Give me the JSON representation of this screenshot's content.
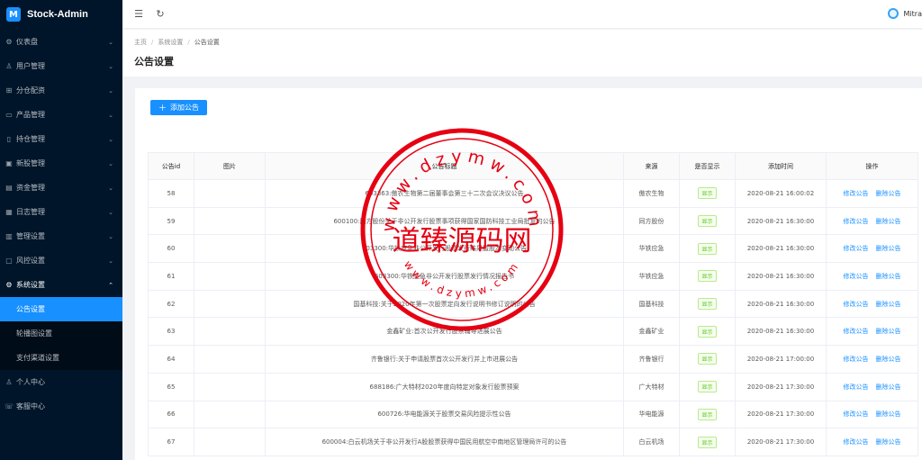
{
  "brand": {
    "logo_letter": "M",
    "name": "Stock-Admin"
  },
  "sidebar": {
    "items": [
      {
        "icon": "dashboard-icon",
        "glyph": "⚙",
        "label": "仪表盘"
      },
      {
        "icon": "user-group-icon",
        "glyph": "♙",
        "label": "用户管理"
      },
      {
        "icon": "org-icon",
        "glyph": "⊞",
        "label": "分仓配资"
      },
      {
        "icon": "product-icon",
        "glyph": "▭",
        "label": "产品管理"
      },
      {
        "icon": "position-icon",
        "glyph": "▯",
        "label": "持仓管理"
      },
      {
        "icon": "stock-icon",
        "glyph": "▣",
        "label": "新股管理"
      },
      {
        "icon": "money-icon",
        "glyph": "▤",
        "label": "资金管理"
      },
      {
        "icon": "log-icon",
        "glyph": "▦",
        "label": "日志管理"
      },
      {
        "icon": "manage-icon",
        "glyph": "▥",
        "label": "管理设置"
      },
      {
        "icon": "risk-icon",
        "glyph": "▢",
        "label": "风控设置"
      }
    ],
    "open_item": {
      "icon": "gear-icon",
      "glyph": "⚙",
      "label": "系统设置"
    },
    "sub_items": [
      "公告设置",
      "轮播图设置",
      "支付渠道设置"
    ],
    "bottom_items": [
      {
        "icon": "person-icon",
        "glyph": "♙",
        "label": "个人中心"
      },
      {
        "icon": "service-icon",
        "glyph": "☏",
        "label": "客服中心"
      }
    ]
  },
  "header": {
    "user_name": "Mitra"
  },
  "breadcrumb": [
    "主页",
    "系统设置",
    "公告设置"
  ],
  "page_title": "公告设置",
  "add_button": "添加公告",
  "table": {
    "columns": [
      "公告id",
      "图片",
      "公告标题",
      "来源",
      "是否显示",
      "添加时间",
      "操作"
    ],
    "rows": [
      {
        "id": "58",
        "title": "603363:傲农生物第二届董事会第三十二次会议决议公告",
        "source": "傲农生物",
        "show": "显示",
        "time": "2020-08-21 16:00:02"
      },
      {
        "id": "59",
        "title": "600100:同方股份关于非公开发行股票事项获得国家国防科技工业局批复的公告",
        "source": "同方股份",
        "show": "显示",
        "time": "2020-08-21 16:30:00"
      },
      {
        "id": "60",
        "title": "603300:华铁应急非公开发行股票发行结果暨股本变动公告",
        "source": "华铁应急",
        "show": "显示",
        "time": "2020-08-21 16:30:00"
      },
      {
        "id": "61",
        "title": "603300:华铁应急非公开发行股票发行情况报告书",
        "source": "华铁应急",
        "show": "显示",
        "time": "2020-08-21 16:30:00"
      },
      {
        "id": "62",
        "title": "国基科技:关于2020年第一次股票定向发行说明书修订说明的公告",
        "source": "国基科技",
        "show": "显示",
        "time": "2020-08-21 16:30:00"
      },
      {
        "id": "63",
        "title": "金鑫矿业:首次公开发行股票辅导进展公告",
        "source": "金鑫矿业",
        "show": "显示",
        "time": "2020-08-21 16:30:00"
      },
      {
        "id": "64",
        "title": "齐鲁银行:关于申请股票首次公开发行并上市进展公告",
        "source": "齐鲁银行",
        "show": "显示",
        "time": "2020-08-21 17:00:00"
      },
      {
        "id": "65",
        "title": "688186:广大特材2020年度向特定对象发行股票预案",
        "source": "广大特材",
        "show": "显示",
        "time": "2020-08-21 17:30:00"
      },
      {
        "id": "66",
        "title": "600726:华电能源关于股票交易风险提示性公告",
        "source": "华电能源",
        "show": "显示",
        "time": "2020-08-21 17:30:00"
      },
      {
        "id": "67",
        "title": "600004:白云机场关于非公开发行A股股票获得中国民用航空中南地区管理局许可的公告",
        "source": "白云机场",
        "show": "显示",
        "time": "2020-08-21 17:30:00"
      }
    ],
    "edit_label": "修改公告",
    "delete_label": "删除公告"
  },
  "watermark": {
    "center_text": "道臻源码网",
    "ring_top": "www.dzymw.com",
    "ring_bottom": "www.dzymw.com"
  },
  "colors": {
    "primary": "#1890ff",
    "sidebar_bg": "#001529",
    "stamp_red": "#e60012",
    "tag_green": "#52c41a"
  }
}
